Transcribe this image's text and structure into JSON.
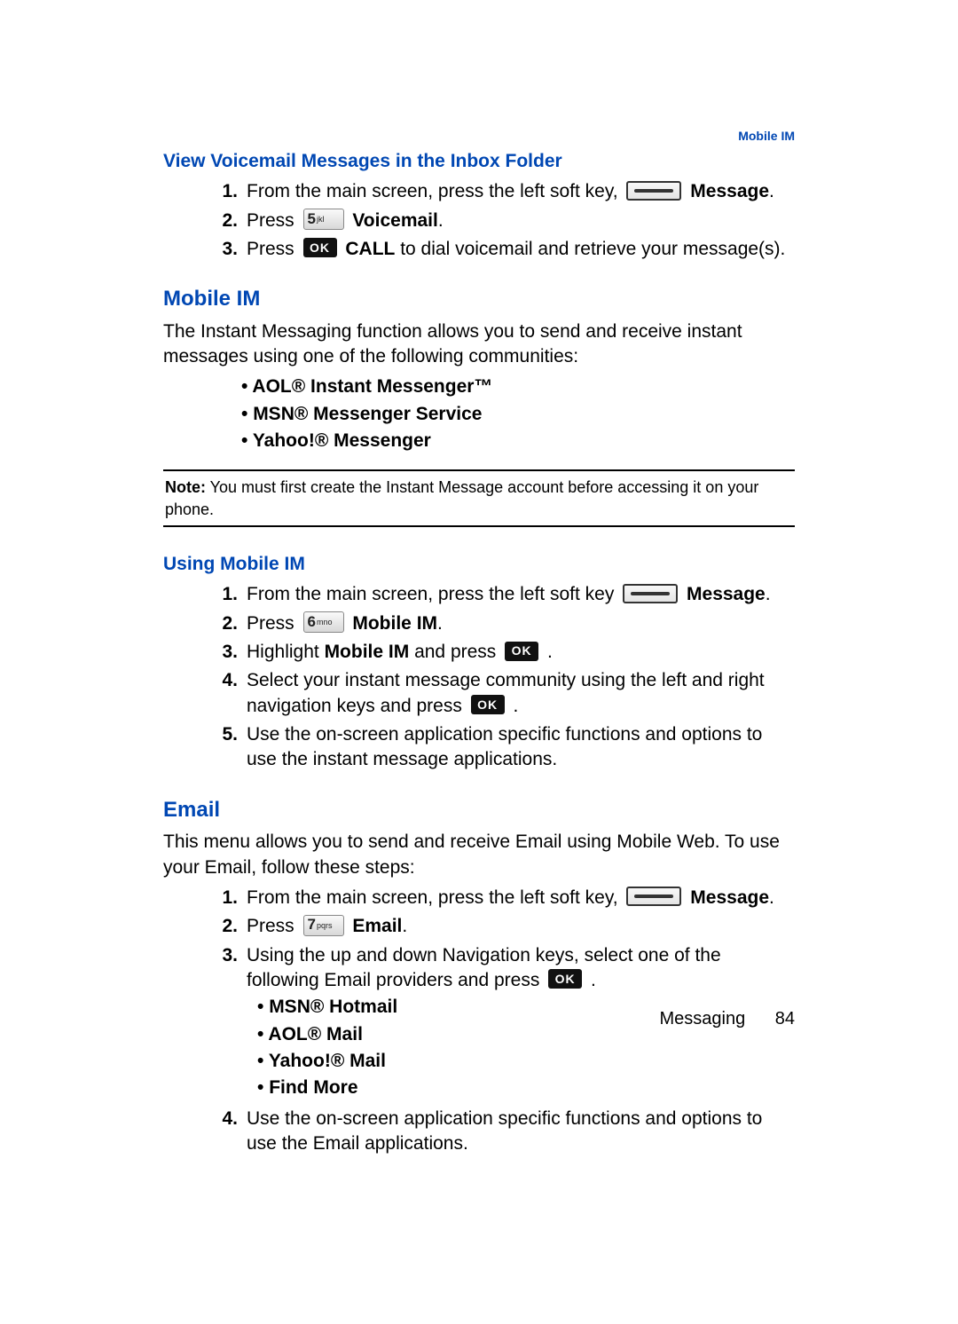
{
  "header_link": "Mobile IM",
  "sec1": {
    "title": "View Voicemail Messages in the Inbox Folder",
    "steps": {
      "s1a": "From the main screen, press the left soft key, ",
      "s1b": "Message",
      "s2a": "Press ",
      "s2b": "Voicemail",
      "s3a": "Press ",
      "s3b": "CALL",
      "s3c": " to dial voicemail and retrieve your message(s)."
    }
  },
  "sec2": {
    "title": "Mobile IM",
    "intro": "The Instant Messaging function allows you to send and receive instant messages using one of the following communities:",
    "bullets": [
      "AOL® Instant Messenger™",
      "MSN® Messenger Service",
      "Yahoo!® Messenger"
    ],
    "note_label": "Note:",
    "note_text": " You must first create the Instant Message account before accessing it on your phone."
  },
  "sec3": {
    "title": "Using Mobile IM",
    "s1a": "From the main screen, press the left soft key ",
    "s1b": "Message",
    "s2a": "Press ",
    "s2b": "Mobile IM",
    "s3a": "Highlight ",
    "s3b": "Mobile IM",
    "s3c": " and press ",
    "s4a": "Select your instant message community using the left and right navigation keys and press ",
    "s5": "Use the on-screen application specific functions and options to use the instant message applications."
  },
  "sec4": {
    "title": "Email",
    "intro": "This menu allows you to send and receive Email using Mobile Web. To use your Email, follow these steps:",
    "s1a": "From the main screen, press the left soft key, ",
    "s1b": "Message",
    "s2a": "Press ",
    "s2b": "Email",
    "s3a": "Using the up and down Navigation keys, select one of the following Email providers and press ",
    "bullets": [
      "MSN® Hotmail",
      "AOL® Mail",
      "Yahoo!® Mail",
      "Find More"
    ],
    "s4": "Use the on-screen application specific functions and options to use the Email applications."
  },
  "footer": {
    "section": "Messaging",
    "page": "84"
  },
  "keys": {
    "k5": "5",
    "k5s": "jkl",
    "k6": "6",
    "k6s": "mno",
    "k7": "7",
    "k7s": "pqrs",
    "ok": "OK"
  }
}
